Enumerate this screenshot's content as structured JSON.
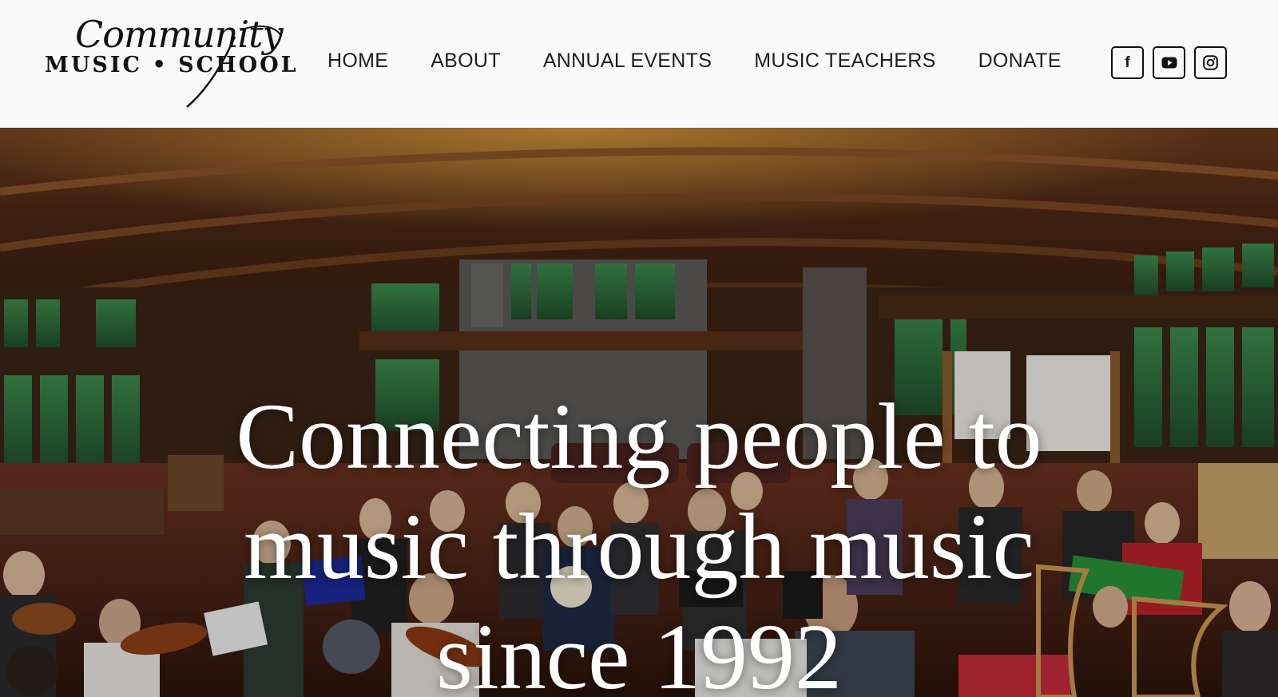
{
  "brand": {
    "logo_script": "Community",
    "logo_caps": "MUSIC • SCHOOL"
  },
  "nav": {
    "items": [
      {
        "label": "HOME"
      },
      {
        "label": "ABOUT"
      },
      {
        "label": "ANNUAL EVENTS"
      },
      {
        "label": "MUSIC TEACHERS"
      },
      {
        "label": "DONATE"
      }
    ]
  },
  "social": [
    {
      "icon": "facebook-icon",
      "glyph": "f"
    },
    {
      "icon": "youtube-icon"
    },
    {
      "icon": "instagram-icon"
    }
  ],
  "hero": {
    "headline": "Connecting people to music through music since 1992"
  },
  "colors": {
    "header_bg": "#fafafa",
    "nav_text": "#1d1d1d",
    "hero_text": "#ffffff"
  }
}
